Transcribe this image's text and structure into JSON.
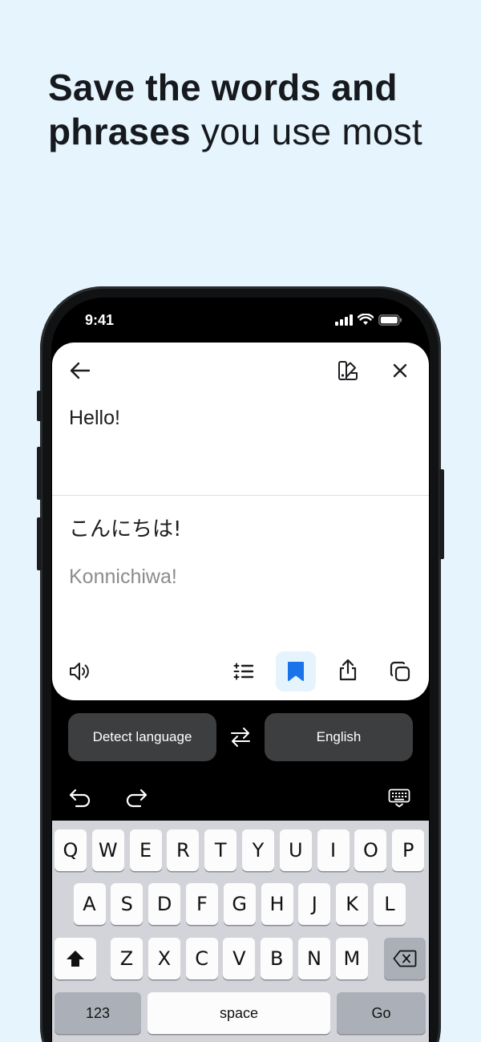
{
  "headline": {
    "bold_line1": "Save the words and",
    "bold_line2": "phrases",
    "light_line2": "you use most"
  },
  "status": {
    "time": "9:41"
  },
  "card": {
    "source_text": "Hello!",
    "target_text": "こんにちは!",
    "transliteration": "Konnichiwa!",
    "icons": [
      "back-arrow-icon",
      "color-palette-icon",
      "close-icon",
      "speaker-icon",
      "list-icon",
      "bookmark-icon",
      "share-icon",
      "copy-icon"
    ],
    "accent_color": "#1a73e8"
  },
  "languages": {
    "source": "Detect language",
    "target": "English"
  },
  "keyboard": {
    "row1": [
      "Q",
      "W",
      "E",
      "R",
      "T",
      "Y",
      "U",
      "I",
      "O",
      "P"
    ],
    "row2": [
      "A",
      "S",
      "D",
      "F",
      "G",
      "H",
      "J",
      "K",
      "L"
    ],
    "row3": [
      "Z",
      "X",
      "C",
      "V",
      "B",
      "N",
      "M"
    ],
    "numbers_label": "123",
    "space_label": "space",
    "go_label": "Go"
  }
}
